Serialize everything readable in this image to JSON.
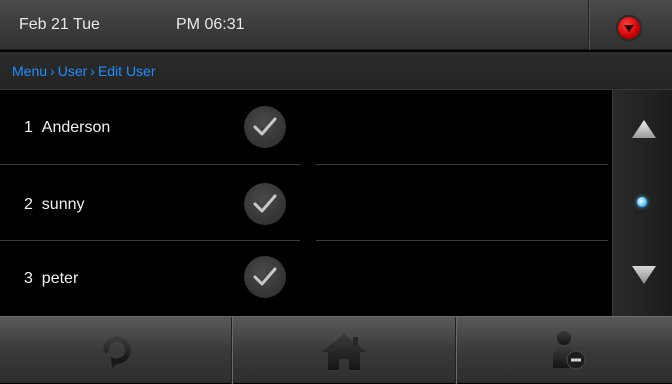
{
  "status_bar": {
    "date": "Feb 21 Tue",
    "time": "PM 06:31",
    "dropdown_icon": "chevron-down-icon",
    "dropdown_color": "#e01010"
  },
  "breadcrumb": {
    "items": [
      "Menu",
      "User",
      "Edit User"
    ],
    "color": "#1e90ff"
  },
  "users": [
    {
      "number": "1",
      "name": "Anderson",
      "checked": true
    },
    {
      "number": "2",
      "name": "sunny",
      "checked": true
    },
    {
      "number": "3",
      "name": "peter",
      "checked": true
    }
  ],
  "scroll": {
    "up_icon": "triangle-up-icon",
    "down_icon": "triangle-down-icon",
    "indicator_color": "#4fc3ff"
  },
  "toolbar": {
    "buttons": [
      {
        "name": "refresh-button",
        "icon": "refresh-icon"
      },
      {
        "name": "home-button",
        "icon": "home-icon"
      },
      {
        "name": "delete-user-button",
        "icon": "remove-user-icon"
      }
    ]
  }
}
